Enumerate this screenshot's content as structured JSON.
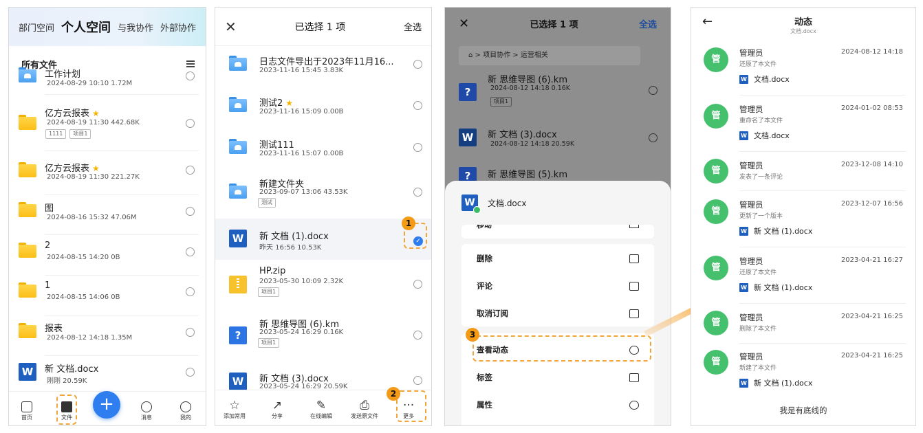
{
  "panel1": {
    "tabs": [
      "部门空间",
      "个人空间",
      "与我协作",
      "外部协作"
    ],
    "section_title": "所有文件",
    "files": [
      {
        "name": "工作计划",
        "meta": "2024-08-29 10:10  1.72M",
        "type": "blue-folder",
        "star": false,
        "tags": []
      },
      {
        "name": "亿方云报表",
        "meta": "2024-08-19 11:30  442.68K",
        "type": "folder",
        "star": true,
        "tags": [
          "1111",
          "项目1"
        ]
      },
      {
        "name": "亿方云报表",
        "meta": "2024-08-19 11:30  221.27K",
        "type": "folder",
        "star": true,
        "tags": []
      },
      {
        "name": "图",
        "meta": "2024-08-16 15:32  47.06M",
        "type": "folder",
        "star": false,
        "tags": []
      },
      {
        "name": "2",
        "meta": "2024-08-15 14:20  0B",
        "type": "folder",
        "star": false,
        "tags": []
      },
      {
        "name": "1",
        "meta": "2024-08-15 14:06  0B",
        "type": "folder",
        "star": false,
        "tags": []
      },
      {
        "name": "报表",
        "meta": "2024-08-12 14:18  1.35M",
        "type": "folder",
        "star": false,
        "tags": []
      },
      {
        "name": "新 文档.docx",
        "meta": "刚刚  20.59K",
        "type": "word",
        "star": false,
        "tags": []
      }
    ],
    "nav": [
      "首页",
      "文件",
      "+",
      "消息",
      "我的"
    ],
    "star_glyph": "★"
  },
  "panel2": {
    "close": "✕",
    "title": "已选择 1 项",
    "select_all": "全选",
    "files": [
      {
        "name": "日志文件导出于2023年11月16...",
        "meta": "2023-11-16 15:45  3.83K",
        "type": "blue-folder",
        "tags": []
      },
      {
        "name": "测试2",
        "meta": "2023-11-16 15:09  0.00B",
        "type": "blue-folder",
        "tags": [],
        "star": true
      },
      {
        "name": "测试111",
        "meta": "2023-11-16 15:07  0.00B",
        "type": "blue-folder",
        "tags": []
      },
      {
        "name": "新建文件夹",
        "meta": "2023-09-07 13:06  43.53K",
        "type": "blue-folder",
        "tags": [
          "测试"
        ]
      },
      {
        "name": "新 文档 (1).docx",
        "meta": "昨天 16:56  10.53K",
        "type": "word",
        "tags": [],
        "selected": true
      },
      {
        "name": "HP.zip",
        "meta": "2023-05-30 10:09  2.32K",
        "type": "zip",
        "tags": [
          "项目1"
        ]
      },
      {
        "name": "新 思维导图 (6).km",
        "meta": "2023-05-24 16:29  0.16K",
        "type": "km",
        "tags": [
          "项目1"
        ]
      },
      {
        "name": "新 文档 (3).docx",
        "meta": "2023-05-24 16:29  20.59K",
        "type": "word",
        "tags": []
      }
    ],
    "bar": [
      "添加常用",
      "分享",
      "在线编辑",
      "发送原文件",
      "更多"
    ],
    "bar_icons": [
      "☆",
      "↗",
      "✎",
      "⎙",
      "···"
    ]
  },
  "panel3": {
    "close": "✕",
    "title": "已选择 1 项",
    "select_all": "全选",
    "breadcrumb": "⌂  >  项目协作  >  运营相关",
    "files": [
      {
        "name": "新 思维导图 (6).km",
        "meta": "2024-08-12 14:18  0.16K",
        "tag": "项目1"
      },
      {
        "name": "新 文档 (3).docx",
        "meta": "2024-08-12 14:18  20.59K"
      },
      {
        "name": "新 思维导图 (5).km",
        "meta": ""
      }
    ],
    "sheet_file": "文档.docx",
    "cut_label": "移动",
    "options": [
      "删除",
      "评论",
      "取消订阅",
      "查看动态",
      "标签",
      "属性"
    ]
  },
  "panel4": {
    "title": "动态",
    "subtitle": "文档.docx",
    "back": "←",
    "activities": [
      {
        "who": "管理员",
        "what": "还原了本文件",
        "when": "2024-08-12 14:18",
        "file": "文档.docx"
      },
      {
        "who": "管理员",
        "what": "重命名了本文件",
        "when": "2024-01-02 08:53",
        "file": "文档.docx"
      },
      {
        "who": "管理员",
        "what": "发表了一条评论",
        "when": "2023-12-08 14:10",
        "file": ""
      },
      {
        "who": "管理员",
        "what": "更新了一个版本",
        "when": "2023-12-07 16:56",
        "file": "新 文档 (1).docx"
      },
      {
        "who": "管理员",
        "what": "还原了本文件",
        "when": "2023-04-21 16:27",
        "file": "新 文档 (1).docx"
      },
      {
        "who": "管理员",
        "what": "删除了本文件",
        "when": "2023-04-21 16:25",
        "file": ""
      },
      {
        "who": "管理员",
        "what": "新建了本文件",
        "when": "2023-04-21 16:25",
        "file": "新 文档 (1).docx"
      }
    ],
    "avatar_text": "管",
    "bottom_note": "我是有底线的"
  },
  "callouts": [
    "1",
    "2",
    "3"
  ],
  "colors": {
    "accent": "#2f7ef0",
    "callout": "#f39b16",
    "avatar": "#45c16e",
    "word": "#1f5fbf"
  }
}
